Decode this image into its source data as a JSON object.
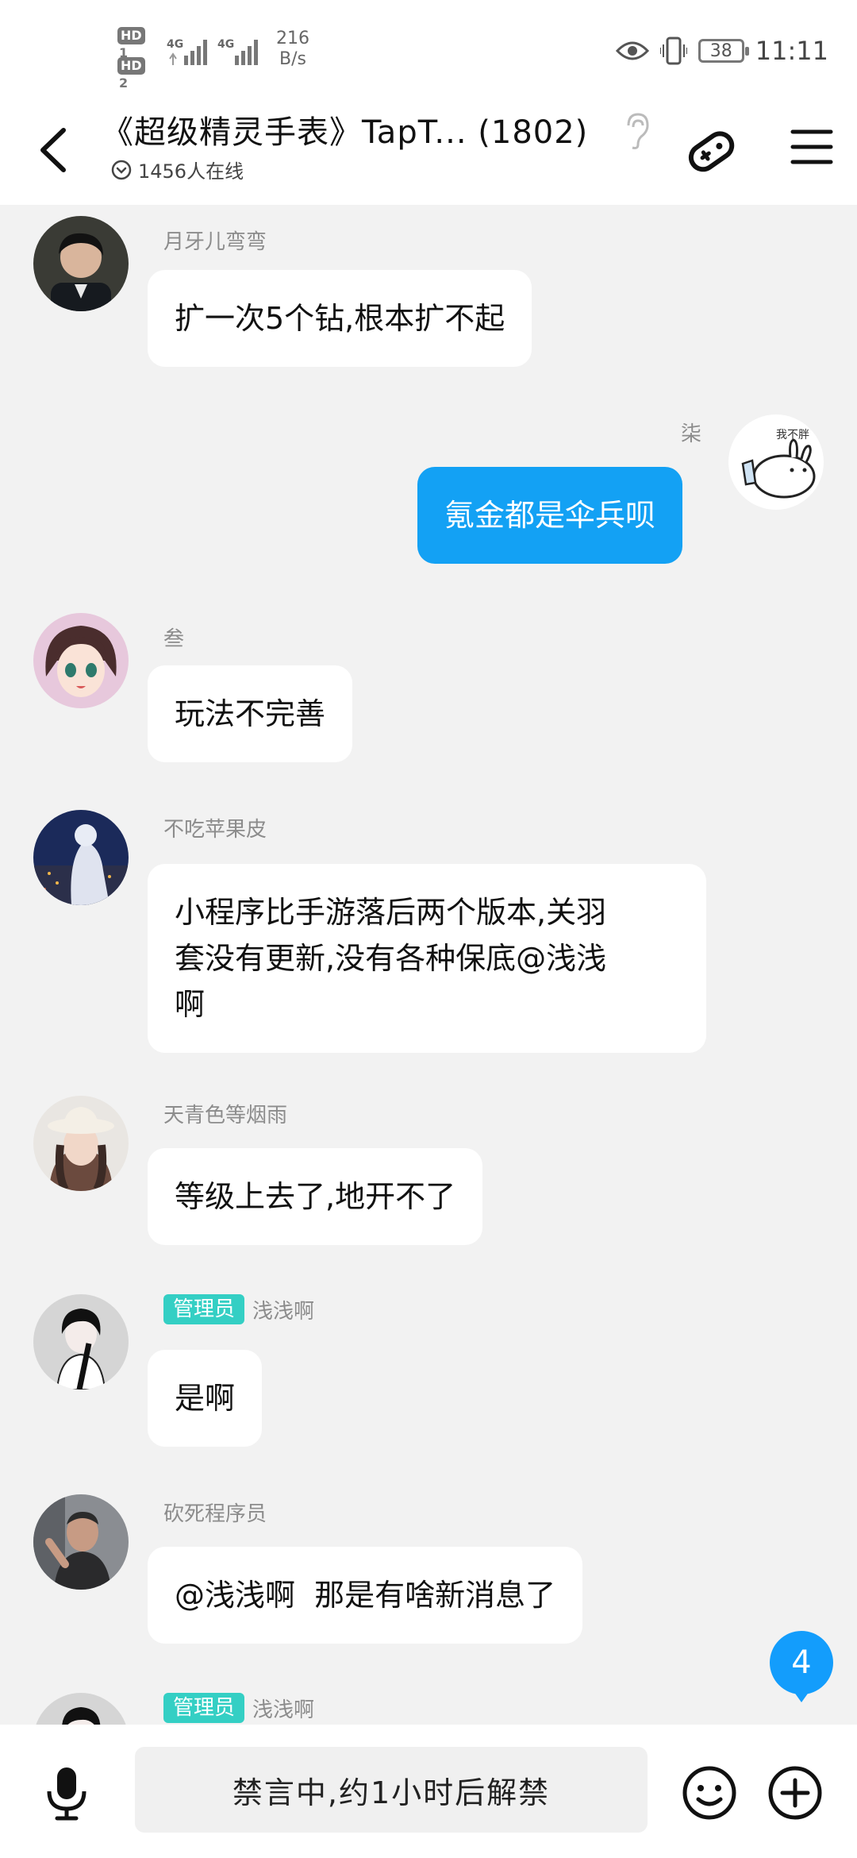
{
  "status_bar": {
    "hd1": "HD",
    "hd1_num": "1",
    "hd2": "HD",
    "hd2_num": "2",
    "net1": "4G",
    "net2": "4G",
    "speed_value": "216",
    "speed_unit": "B/s",
    "battery": "38",
    "time": "11:11"
  },
  "header": {
    "title": "《超级精灵手表》TapT... (1802)",
    "online": "1456人在线"
  },
  "messages": [
    {
      "sender": "月牙儿弯弯",
      "role": "",
      "text_lines": [
        "扩一次5个钻,根本扩不起"
      ],
      "side": "left",
      "avatar_icon": "boy-avatar"
    },
    {
      "sender": "柒",
      "role": "",
      "text_lines": [
        "氪金都是伞兵呗"
      ],
      "side": "right",
      "avatar_icon": "cartoon-rabbit-avatar"
    },
    {
      "sender": "叁",
      "role": "",
      "text_lines": [
        "玩法不完善"
      ],
      "side": "left",
      "avatar_icon": "anime-girl-avatar"
    },
    {
      "sender": "不吃苹果皮",
      "role": "",
      "text_lines": [
        "小程序比手游落后两个版本,关羽",
        "套没有更新,没有各种保底@浅浅",
        "啊"
      ],
      "side": "left",
      "avatar_icon": "night-city-avatar"
    },
    {
      "sender": "天青色等烟雨",
      "role": "",
      "text_lines": [
        "等级上去了,地开不了"
      ],
      "side": "left",
      "avatar_icon": "girl-hat-avatar"
    },
    {
      "sender": "浅浅啊",
      "role": "管理员",
      "text_lines": [
        "是啊"
      ],
      "side": "left",
      "avatar_icon": "anime-boy-avatar"
    },
    {
      "sender": "砍死程序员",
      "role": "",
      "text_lines": [
        "@浅浅啊  那是有啥新消息了"
      ],
      "side": "left",
      "avatar_icon": "man-avatar"
    },
    {
      "sender": "浅浅啊",
      "role": "管理员",
      "text_lines": [],
      "side": "left",
      "avatar_icon": "anime-boy-avatar"
    }
  ],
  "new_message_count": "4",
  "bottom": {
    "input_text": "禁言中,约1小时后解禁"
  },
  "colors": {
    "accent": "#13a1f4",
    "admin_badge": "#34cfc4",
    "background": "#f2f2f2"
  }
}
